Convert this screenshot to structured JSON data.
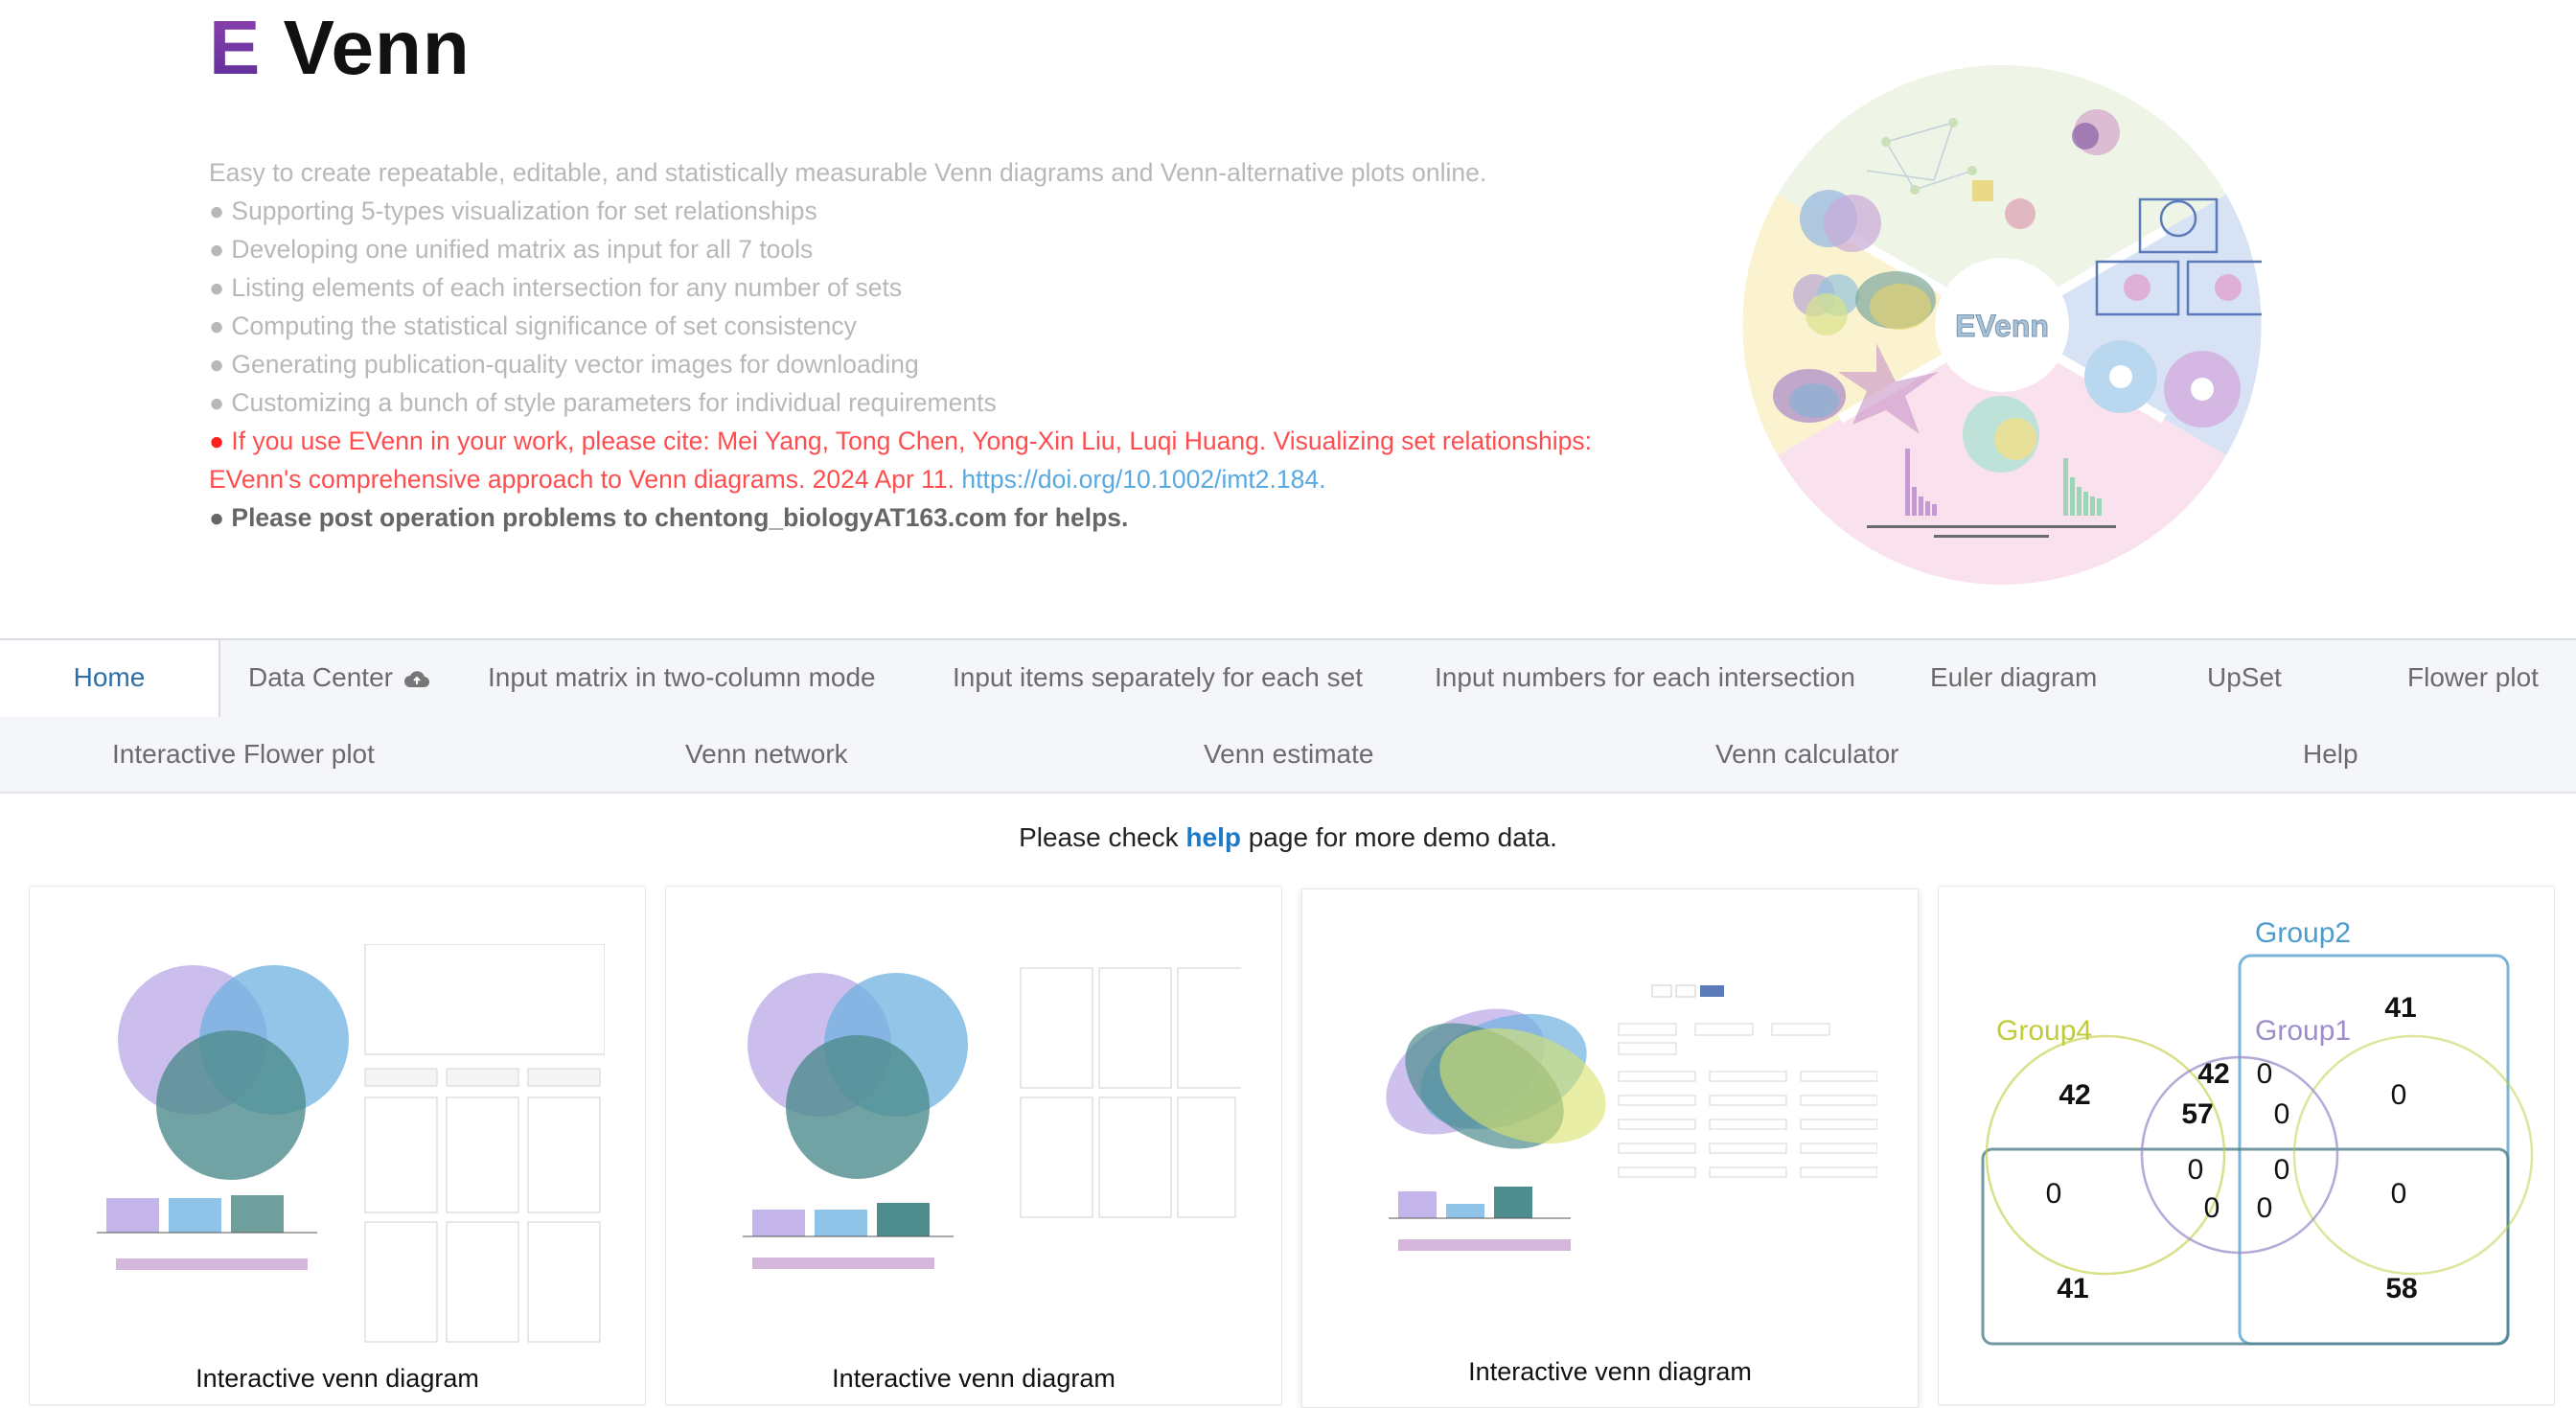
{
  "header": {
    "logo_letter": "E",
    "logo_word": "Venn",
    "tagline": "Easy to create repeatable, editable, and statistically measurable Venn diagrams and Venn-alternative plots online.",
    "features": [
      "Supporting 5-types visualization for set relationships",
      "Developing one unified matrix as input for all 7 tools",
      "Listing elements of each intersection for any number of sets",
      "Computing the statistical significance of set consistency",
      "Generating publication-quality vector images for downloading",
      "Customizing a bunch of style parameters for individual requirements"
    ],
    "bullet": "●",
    "citation_text": "If you use EVenn in your work, please cite: Mei Yang, Tong Chen, Yong-Xin Liu, Luqi Huang. Visualizing set relationships: EVenn's comprehensive approach to Venn diagrams. 2024 Apr 11.",
    "citation_link": "https://doi.org/10.1002/imt2.184.",
    "contact": "Please post operation problems to chentong_biologyAT163.com for helps.",
    "wheel_center_label": "EVenn"
  },
  "nav": {
    "row1": [
      {
        "label": "Home",
        "active": true
      },
      {
        "label": "Data Center",
        "icon": "cloud-upload-icon"
      },
      {
        "label": "Input matrix in two-column mode"
      },
      {
        "label": "Input items separately for each set"
      },
      {
        "label": "Input numbers for each intersection"
      },
      {
        "label": "Euler diagram"
      },
      {
        "label": "UpSet"
      },
      {
        "label": "Flower plot"
      }
    ],
    "row2": [
      {
        "label": "Interactive Flower plot"
      },
      {
        "label": "Venn network"
      },
      {
        "label": "Venn estimate"
      },
      {
        "label": "Venn calculator"
      },
      {
        "label": "Help"
      }
    ]
  },
  "notice": {
    "before": "Please check",
    "link": "help",
    "after": "page for more demo data."
  },
  "cards": [
    {
      "title": "Interactive venn diagram"
    },
    {
      "title": "Interactive venn diagram"
    },
    {
      "title": "Interactive venn diagram"
    },
    {
      "title": "",
      "venn": {
        "labels": {
          "group2": "Group2",
          "group4": "Group4",
          "group1": "Group1"
        },
        "numbers": [
          "41",
          "42",
          "42",
          "0",
          "57",
          "0",
          "0",
          "0",
          "0",
          "0",
          "0",
          "0",
          "0",
          "0",
          "41",
          "58"
        ]
      }
    }
  ],
  "colors": {
    "accent": "#2d6ea8",
    "purple": "#b39ddb",
    "blue": "#64aee0",
    "teal": "#4e8a8f",
    "group2": "#4d9ccc",
    "group4": "#c0cc3a",
    "group1": "#9e8ccb"
  }
}
